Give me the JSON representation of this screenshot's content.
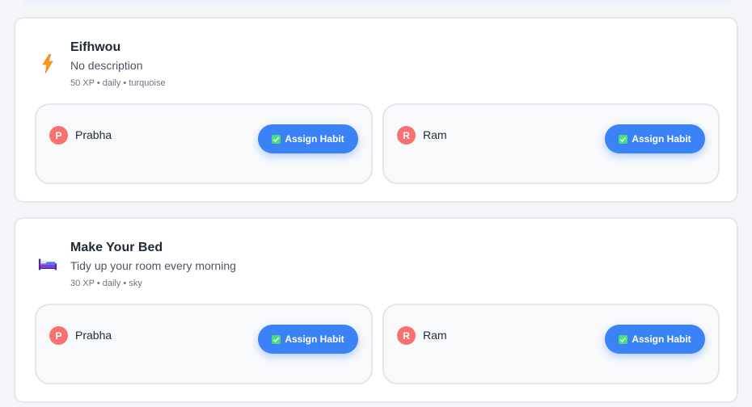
{
  "habits": [
    {
      "icon": "lightning-bolt-icon",
      "title": "Eifhwou",
      "description": "No description",
      "meta": "50 XP • daily • turquoise",
      "members": [
        {
          "initial": "P",
          "name": "Prabha",
          "button_label": "Assign Habit"
        },
        {
          "initial": "R",
          "name": "Ram",
          "button_label": "Assign Habit"
        }
      ]
    },
    {
      "icon": "bed-icon",
      "title": "Make Your Bed",
      "description": "Tidy up your room every morning",
      "meta": "30 XP • daily • sky",
      "members": [
        {
          "initial": "P",
          "name": "Prabha",
          "button_label": "Assign Habit"
        },
        {
          "initial": "R",
          "name": "Ram",
          "button_label": "Assign Habit"
        }
      ]
    }
  ],
  "colors": {
    "accent": "#3b82f6",
    "avatar": "#f87171",
    "check": "#4ade80"
  }
}
